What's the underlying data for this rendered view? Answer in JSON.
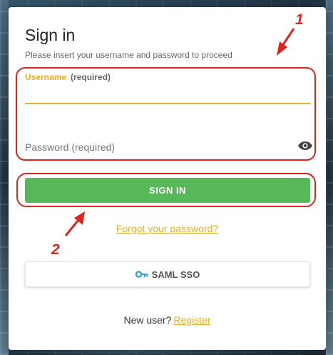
{
  "login": {
    "title": "Sign in",
    "subtitle": "Please insert your username and password to proceed",
    "username_label": "Username",
    "username_required": "(required)",
    "username_value": "",
    "password_placeholder": "Password (required)",
    "signin_label": "SIGN IN",
    "forgot_label": "Forgot your password?",
    "saml_label": "SAML SSO",
    "new_user_text": "New user?",
    "register_label": "Register"
  },
  "annotations": {
    "marker_1": "1",
    "marker_2": "2"
  },
  "icons": {
    "password_toggle": "eye-icon",
    "saml": "key-icon"
  },
  "colors": {
    "accent": "#f0ad2a",
    "primary_button": "#56b858",
    "annotation": "#e0231c",
    "saml_icon": "#2a9fd8"
  }
}
